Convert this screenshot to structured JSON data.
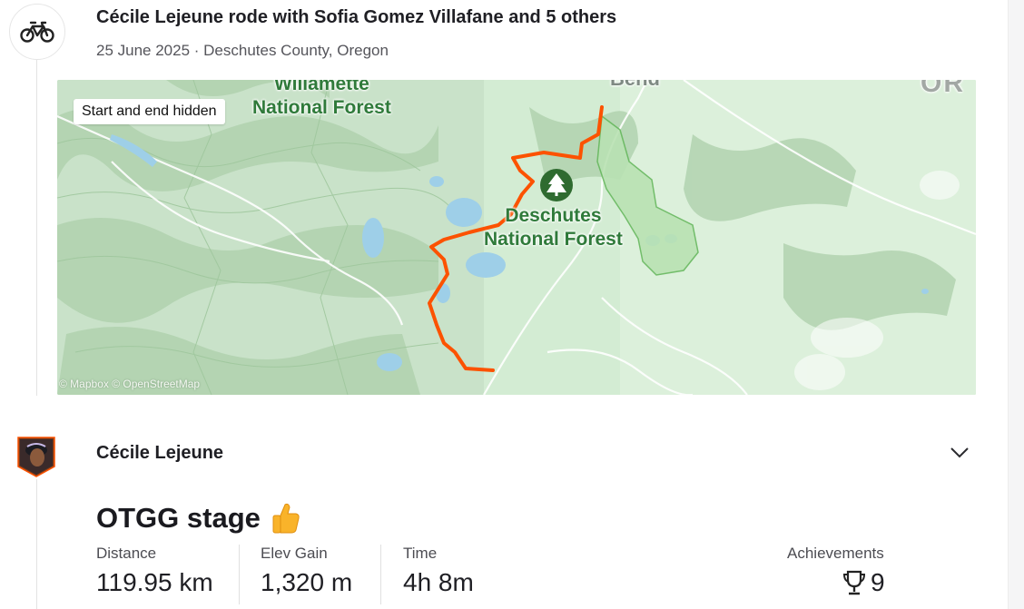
{
  "header": {
    "sport_icon": "bicycle-icon",
    "title": "Cécile Lejeune rode with Sofia Gomez Villafane and 5 others",
    "meta": "25 June 2025 · Deschutes County, Oregon"
  },
  "map": {
    "privacy_chip": "Start and end hidden",
    "attribution": "© Mapbox © OpenStreetMap",
    "labels": {
      "willamette": "Willamette\nNational Forest",
      "deschutes": "Deschutes\nNational Forest",
      "bend": "Bend",
      "state": "OR"
    },
    "route_color": "#fc5200",
    "poi_icon": "tree-icon"
  },
  "athlete": {
    "name": "Cécile Lejeune",
    "avatar_icon": "avatar",
    "menu_icon": "chevron-down-icon"
  },
  "activity": {
    "title": "OTGG stage",
    "kudos_icon": "thumbs-up-icon",
    "stats": [
      {
        "label": "Distance",
        "value": "119.95 km"
      },
      {
        "label": "Elev Gain",
        "value": "1,320 m"
      },
      {
        "label": "Time",
        "value": "4h 8m"
      }
    ],
    "achievements": {
      "label": "Achievements",
      "icon": "trophy-icon",
      "count": "9"
    }
  }
}
